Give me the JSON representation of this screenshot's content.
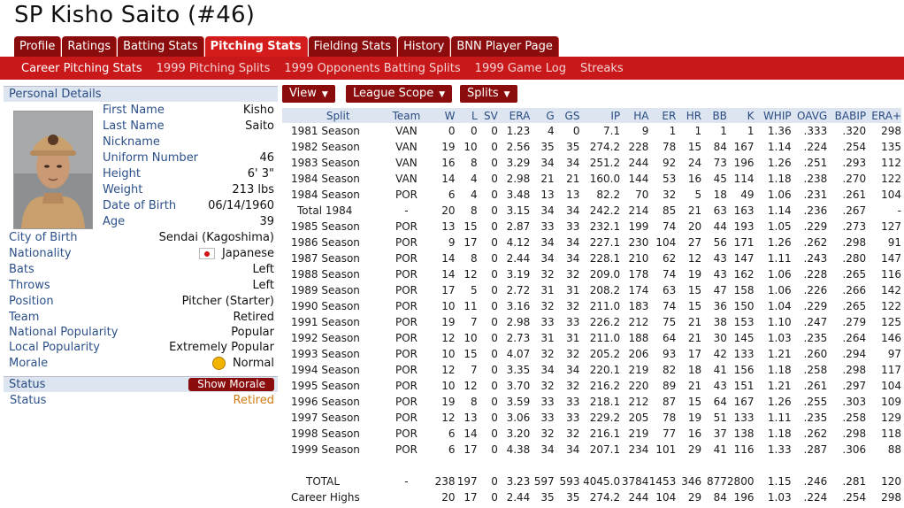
{
  "title": "SP Kisho Saito (#46)",
  "tabs": [
    "Profile",
    "Ratings",
    "Batting Stats",
    "Pitching Stats",
    "Fielding Stats",
    "History",
    "BNN Player Page"
  ],
  "active_tab": 3,
  "subnav": [
    "Career Pitching Stats",
    "1999 Pitching Splits",
    "1999 Opponents Batting Splits",
    "1999 Game Log",
    "Streaks"
  ],
  "personal": {
    "header": "Personal Details",
    "first_name_label": "First Name",
    "first_name": "Kisho",
    "last_name_label": "Last Name",
    "last_name": "Saito",
    "nickname_label": "Nickname",
    "nickname": "",
    "uniform_label": "Uniform Number",
    "uniform": "46",
    "height_label": "Height",
    "height": "6' 3\"",
    "weight_label": "Weight",
    "weight": "213 lbs",
    "dob_label": "Date of Birth",
    "dob": "06/14/1960",
    "age_label": "Age",
    "age": "39",
    "city_label": "City of Birth",
    "city": "Sendai (Kagoshima)",
    "nationality_label": "Nationality",
    "nationality": "Japanese",
    "bats_label": "Bats",
    "bats": "Left",
    "throws_label": "Throws",
    "throws": "Left",
    "position_label": "Position",
    "position": "Pitcher (Starter)",
    "team_label": "Team",
    "team": "Retired",
    "natpop_label": "National Popularity",
    "natpop": "Popular",
    "locpop_label": "Local Popularity",
    "locpop": "Extremely Popular",
    "morale_label": "Morale",
    "morale": "Normal"
  },
  "status": {
    "header": "Status",
    "button": "Show Morale",
    "label": "Status",
    "value": "Retired",
    "value_color": "#d07a10"
  },
  "dropdowns": [
    "View",
    "League Scope",
    "Splits"
  ],
  "columns": [
    "Split",
    "Team",
    "W",
    "L",
    "SV",
    "ERA",
    "G",
    "GS",
    "IP",
    "HA",
    "ER",
    "HR",
    "BB",
    "K",
    "WHIP",
    "OAVG",
    "BABIP",
    "ERA+"
  ],
  "rows": [
    [
      "1981 Season",
      "VAN",
      "0",
      "0",
      "0",
      "1.23",
      "4",
      "0",
      "7.1",
      "9",
      "1",
      "1",
      "1",
      "1",
      "1.36",
      ".333",
      ".320",
      "298"
    ],
    [
      "1982 Season",
      "VAN",
      "19",
      "10",
      "0",
      "2.56",
      "35",
      "35",
      "274.2",
      "228",
      "78",
      "15",
      "84",
      "167",
      "1.14",
      ".224",
      ".254",
      "135"
    ],
    [
      "1983 Season",
      "VAN",
      "16",
      "8",
      "0",
      "3.29",
      "34",
      "34",
      "251.2",
      "244",
      "92",
      "24",
      "73",
      "196",
      "1.26",
      ".251",
      ".293",
      "112"
    ],
    [
      "1984 Season",
      "VAN",
      "14",
      "4",
      "0",
      "2.98",
      "21",
      "21",
      "160.0",
      "144",
      "53",
      "16",
      "45",
      "114",
      "1.18",
      ".238",
      ".270",
      "122"
    ],
    [
      "1984 Season",
      "POR",
      "6",
      "4",
      "0",
      "3.48",
      "13",
      "13",
      "82.2",
      "70",
      "32",
      "5",
      "18",
      "49",
      "1.06",
      ".231",
      ".261",
      "104"
    ],
    [
      "Total 1984",
      "-",
      "20",
      "8",
      "0",
      "3.15",
      "34",
      "34",
      "242.2",
      "214",
      "85",
      "21",
      "63",
      "163",
      "1.14",
      ".236",
      ".267",
      "-"
    ],
    [
      "1985 Season",
      "POR",
      "13",
      "15",
      "0",
      "2.87",
      "33",
      "33",
      "232.1",
      "199",
      "74",
      "20",
      "44",
      "193",
      "1.05",
      ".229",
      ".273",
      "127"
    ],
    [
      "1986 Season",
      "POR",
      "9",
      "17",
      "0",
      "4.12",
      "34",
      "34",
      "227.1",
      "230",
      "104",
      "27",
      "56",
      "171",
      "1.26",
      ".262",
      ".298",
      "91"
    ],
    [
      "1987 Season",
      "POR",
      "14",
      "8",
      "0",
      "2.44",
      "34",
      "34",
      "228.1",
      "210",
      "62",
      "12",
      "43",
      "147",
      "1.11",
      ".243",
      ".280",
      "147"
    ],
    [
      "1988 Season",
      "POR",
      "14",
      "12",
      "0",
      "3.19",
      "32",
      "32",
      "209.0",
      "178",
      "74",
      "19",
      "43",
      "162",
      "1.06",
      ".228",
      ".265",
      "116"
    ],
    [
      "1989 Season",
      "POR",
      "17",
      "5",
      "0",
      "2.72",
      "31",
      "31",
      "208.2",
      "174",
      "63",
      "15",
      "47",
      "158",
      "1.06",
      ".226",
      ".266",
      "142"
    ],
    [
      "1990 Season",
      "POR",
      "10",
      "11",
      "0",
      "3.16",
      "32",
      "32",
      "211.0",
      "183",
      "74",
      "15",
      "36",
      "150",
      "1.04",
      ".229",
      ".265",
      "122"
    ],
    [
      "1991 Season",
      "POR",
      "19",
      "7",
      "0",
      "2.98",
      "33",
      "33",
      "226.2",
      "212",
      "75",
      "21",
      "38",
      "153",
      "1.10",
      ".247",
      ".279",
      "125"
    ],
    [
      "1992 Season",
      "POR",
      "12",
      "10",
      "0",
      "2.73",
      "31",
      "31",
      "211.0",
      "188",
      "64",
      "21",
      "30",
      "145",
      "1.03",
      ".235",
      ".264",
      "146"
    ],
    [
      "1993 Season",
      "POR",
      "10",
      "15",
      "0",
      "4.07",
      "32",
      "32",
      "205.2",
      "206",
      "93",
      "17",
      "42",
      "133",
      "1.21",
      ".260",
      ".294",
      "97"
    ],
    [
      "1994 Season",
      "POR",
      "12",
      "7",
      "0",
      "3.35",
      "34",
      "34",
      "220.1",
      "219",
      "82",
      "18",
      "41",
      "156",
      "1.18",
      ".258",
      ".298",
      "117"
    ],
    [
      "1995 Season",
      "POR",
      "10",
      "12",
      "0",
      "3.70",
      "32",
      "32",
      "216.2",
      "220",
      "89",
      "21",
      "43",
      "151",
      "1.21",
      ".261",
      ".297",
      "104"
    ],
    [
      "1996 Season",
      "POR",
      "19",
      "8",
      "0",
      "3.59",
      "33",
      "33",
      "218.1",
      "212",
      "87",
      "15",
      "64",
      "167",
      "1.26",
      ".255",
      ".303",
      "109"
    ],
    [
      "1997 Season",
      "POR",
      "12",
      "13",
      "0",
      "3.06",
      "33",
      "33",
      "229.2",
      "205",
      "78",
      "19",
      "51",
      "133",
      "1.11",
      ".235",
      ".258",
      "129"
    ],
    [
      "1998 Season",
      "POR",
      "6",
      "14",
      "0",
      "3.20",
      "32",
      "32",
      "216.1",
      "219",
      "77",
      "16",
      "37",
      "138",
      "1.18",
      ".262",
      ".298",
      "118"
    ],
    [
      "1999 Season",
      "POR",
      "6",
      "17",
      "0",
      "4.38",
      "34",
      "34",
      "207.1",
      "234",
      "101",
      "29",
      "41",
      "116",
      "1.33",
      ".287",
      ".306",
      "88"
    ]
  ],
  "total_row": [
    "TOTAL",
    "-",
    "238",
    "197",
    "0",
    "3.23",
    "597",
    "593",
    "4045.0",
    "3784",
    "1453",
    "346",
    "877",
    "2800",
    "1.15",
    ".246",
    ".281",
    "120"
  ],
  "highs_row": [
    "Career Highs",
    "",
    "20",
    "17",
    "0",
    "2.44",
    "35",
    "35",
    "274.2",
    "244",
    "104",
    "29",
    "84",
    "196",
    "1.03",
    ".224",
    ".254",
    "298"
  ]
}
